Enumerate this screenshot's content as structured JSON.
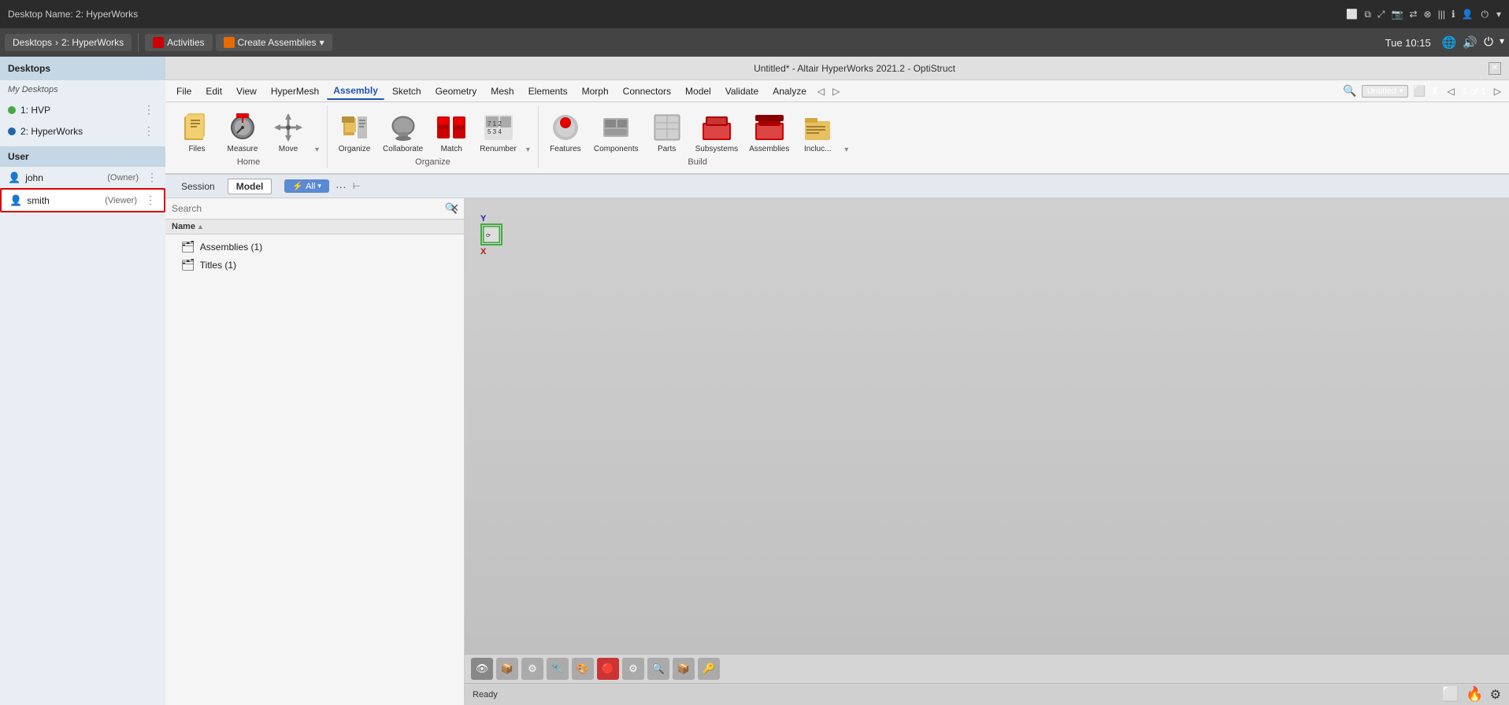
{
  "system": {
    "desktop_name": "Desktop Name: 2: HyperWorks",
    "time": "Tue 10:15",
    "icons": [
      "monitor",
      "copy",
      "expand",
      "photo",
      "share",
      "cancel",
      "bars",
      "info",
      "user"
    ]
  },
  "taskbar": {
    "desktops_label": "Desktops",
    "breadcrumb_sep": "›",
    "breadcrumb_current": "2: HyperWorks",
    "items": [
      {
        "id": "activities",
        "label": "Activities",
        "icon": "red"
      },
      {
        "id": "create-assemblies",
        "label": "Create Assemblies",
        "icon": "orange",
        "has_dropdown": true
      }
    ]
  },
  "sidebar": {
    "desktops_header": "Desktops",
    "my_desktops_label": "My Desktops",
    "desktop_items": [
      {
        "id": "hvp",
        "label": "1: HVP",
        "color": "green",
        "has_menu": true
      },
      {
        "id": "hyperworks",
        "label": "2: HyperWorks",
        "color": "blue",
        "has_menu": true
      }
    ],
    "user_header": "User",
    "user_items": [
      {
        "id": "john",
        "name": "john",
        "role": "(Owner)",
        "has_menu": true,
        "selected": false
      },
      {
        "id": "smith",
        "name": "smith",
        "role": "(Viewer)",
        "has_menu": true,
        "selected": true
      }
    ]
  },
  "window": {
    "title": "Untitled* - Altair HyperWorks 2021.2 - OptiStruct",
    "close_btn": "✕",
    "min_btn": "─",
    "max_btn": "□"
  },
  "menubar": {
    "items": [
      "File",
      "Edit",
      "View",
      "HyperMesh",
      "Assembly",
      "Sketch",
      "Geometry",
      "Mesh",
      "Elements",
      "Morph",
      "Connectors",
      "Model",
      "Validate",
      "Analyze",
      "◁",
      "▷"
    ],
    "active_item": "Assembly",
    "page_nav": {
      "prev": "◁",
      "next": "▷",
      "tab_label": "Untitled",
      "page_info": "1 of 1"
    }
  },
  "ribbon": {
    "groups": [
      {
        "id": "home",
        "label": "Home",
        "items": [
          {
            "id": "files",
            "label": "Files",
            "icon": "📁"
          },
          {
            "id": "measure",
            "label": "Measure",
            "icon": "📐"
          },
          {
            "id": "move",
            "label": "Move",
            "icon": "⚙"
          }
        ],
        "has_expand": true
      },
      {
        "id": "organize-group",
        "label": "Organize",
        "items": [
          {
            "id": "organize",
            "label": "Organize",
            "icon": "🗂"
          },
          {
            "id": "collaborate",
            "label": "Collaborate",
            "icon": "💾"
          },
          {
            "id": "match",
            "label": "Match",
            "icon": "🔧"
          },
          {
            "id": "renumber",
            "label": "Renumber",
            "icon": "🔢"
          }
        ],
        "has_expand": true
      },
      {
        "id": "build-group",
        "label": "Build",
        "items": [
          {
            "id": "features",
            "label": "Features",
            "icon": "🔴"
          },
          {
            "id": "components",
            "label": "Components",
            "icon": "⬜"
          },
          {
            "id": "parts",
            "label": "Parts",
            "icon": "📋"
          },
          {
            "id": "subsystems",
            "label": "Subsystems",
            "icon": "🏗"
          },
          {
            "id": "assemblies",
            "label": "Assemblies",
            "icon": "🏛"
          },
          {
            "id": "include",
            "label": "Incluc...",
            "icon": "📁"
          }
        ],
        "has_expand": true
      }
    ]
  },
  "sub_ribbon": {
    "tabs": [
      {
        "id": "session",
        "label": "Session",
        "active": false
      },
      {
        "id": "model",
        "label": "Model",
        "active": true
      }
    ],
    "filter_btn": "⚡ All",
    "dots_btn": "···",
    "page_btn": "⊢"
  },
  "file_panel": {
    "search_placeholder": "Search",
    "col_name": "Name",
    "col_sort": "▲",
    "tree_items": [
      {
        "id": "assemblies",
        "label": "Assemblies (1)",
        "icon": "🗂"
      },
      {
        "id": "titles",
        "label": "Titles (1)",
        "icon": "🗂"
      }
    ]
  },
  "viewport": {
    "axis_y": "Y",
    "axis_x": "X",
    "status": "Ready",
    "toolbar_icons": [
      "👁",
      "📦",
      "⚙",
      "🔧",
      "📋",
      "🔴",
      "⚙",
      "🔍",
      "📦",
      "🔑"
    ]
  }
}
